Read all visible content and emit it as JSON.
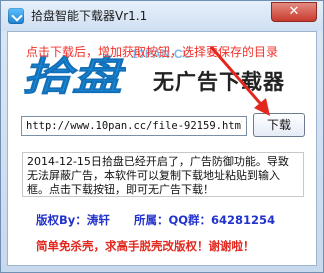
{
  "window": {
    "title": "拾盘智能下载器Vr1.1",
    "close_label": "✕"
  },
  "banner": {
    "hint": "点击下载后，增加获取按钮，选择要保存的目录",
    "logo_text": "拾盘",
    "url_text": "10PAN.CC",
    "slogan": "无广告下载器"
  },
  "form": {
    "url_value": "http://www.10pan.cc/file-92159.html",
    "download_label": "下载"
  },
  "notice": {
    "text": "2014-12-15日拾盘已经开启了，广告防御功能。导致无法屏蔽广告，本软件可以复制下载地址粘贴到输入框。点击下载按钮，即可无广告下载！"
  },
  "credits": {
    "author": "版权By：涛轩",
    "owner": "所属：QQ群：64281254"
  },
  "footer": {
    "text": "简单免杀壳，求高手脱壳改版权！谢谢啦！"
  },
  "colors": {
    "accent_blue": "#1c8fe0",
    "hint_red": "#f2312a",
    "credit_blue": "#2233cc",
    "footer_red": "#e2281e"
  }
}
